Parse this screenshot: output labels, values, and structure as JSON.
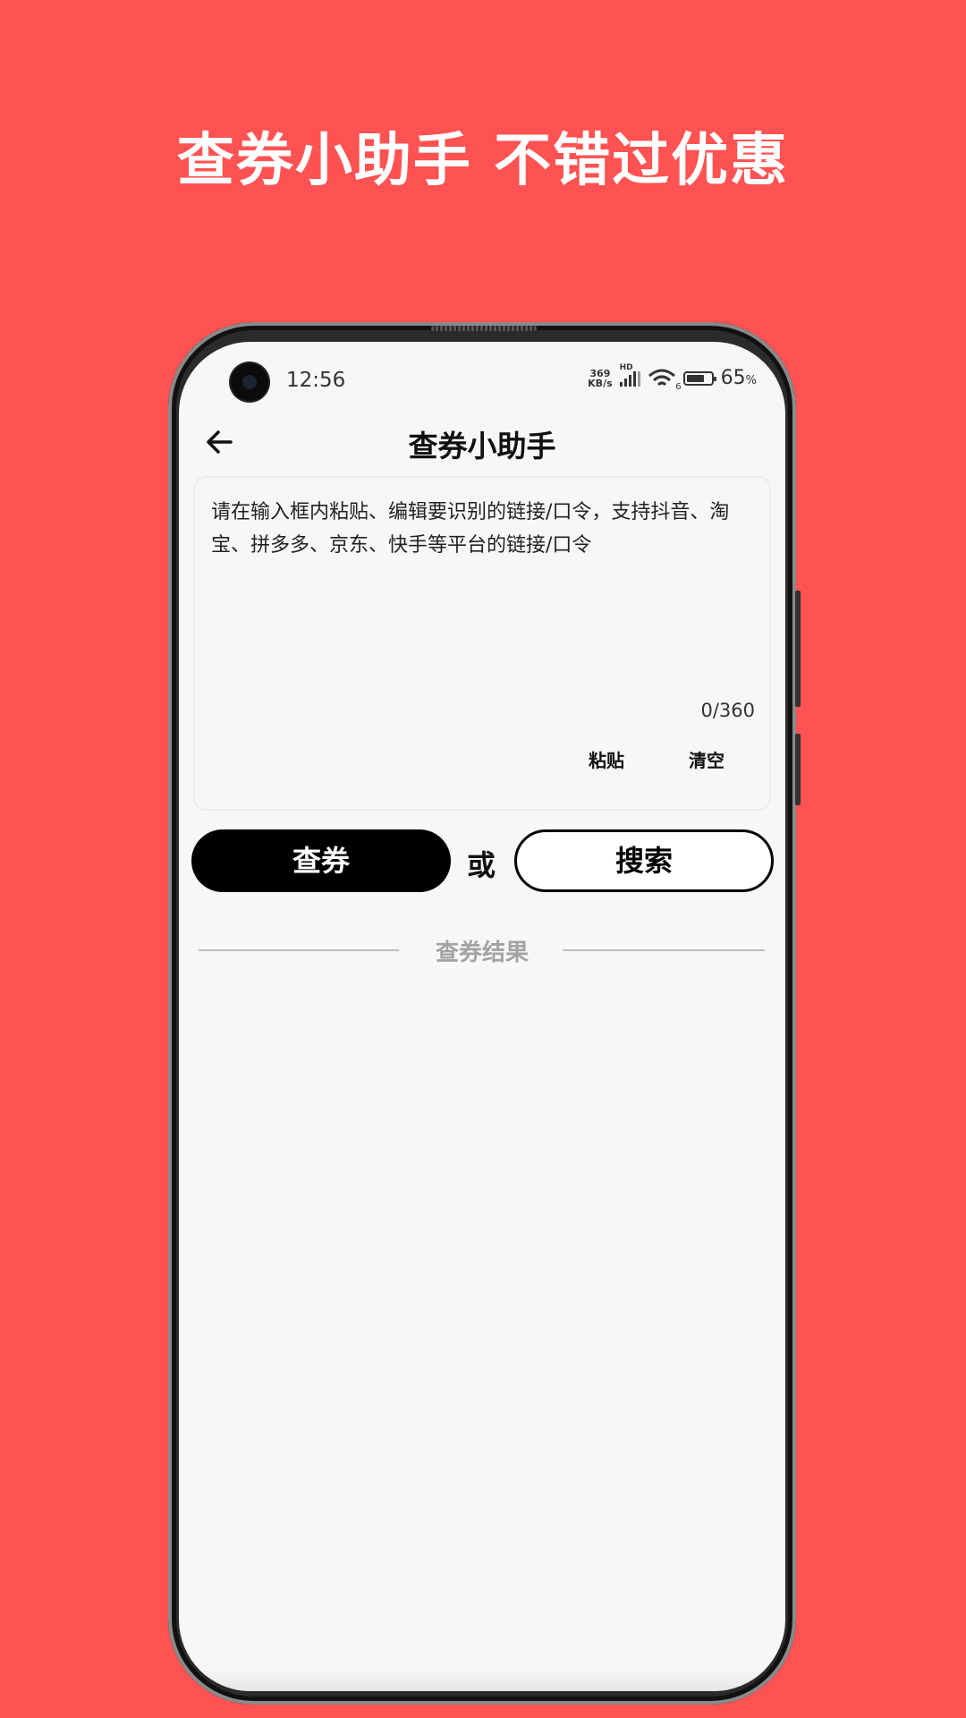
{
  "promo": {
    "headline": "查券小助手 不错过优惠"
  },
  "status_bar": {
    "time": "12:56",
    "net_speed_value": "369",
    "net_speed_unit": "KB/s",
    "signal_label": "HD",
    "wifi_label": "6",
    "battery_level": "65",
    "battery_unit": "%"
  },
  "nav": {
    "title": "查券小助手",
    "back_icon": "arrow-left-icon"
  },
  "input": {
    "placeholder": "请在输入框内粘贴、编辑要识别的链接/口令，支持抖音、淘宝、拼多多、京东、快手等平台的链接/口令",
    "counter": "0/360",
    "paste_label": "粘贴",
    "clear_label": "清空"
  },
  "actions": {
    "coupon_label": "查券",
    "or_label": "或",
    "search_label": "搜索"
  },
  "results": {
    "label": "查券结果"
  },
  "colors": {
    "background": "#ff5252",
    "primary": "#000000",
    "muted": "#a3a3a3"
  }
}
